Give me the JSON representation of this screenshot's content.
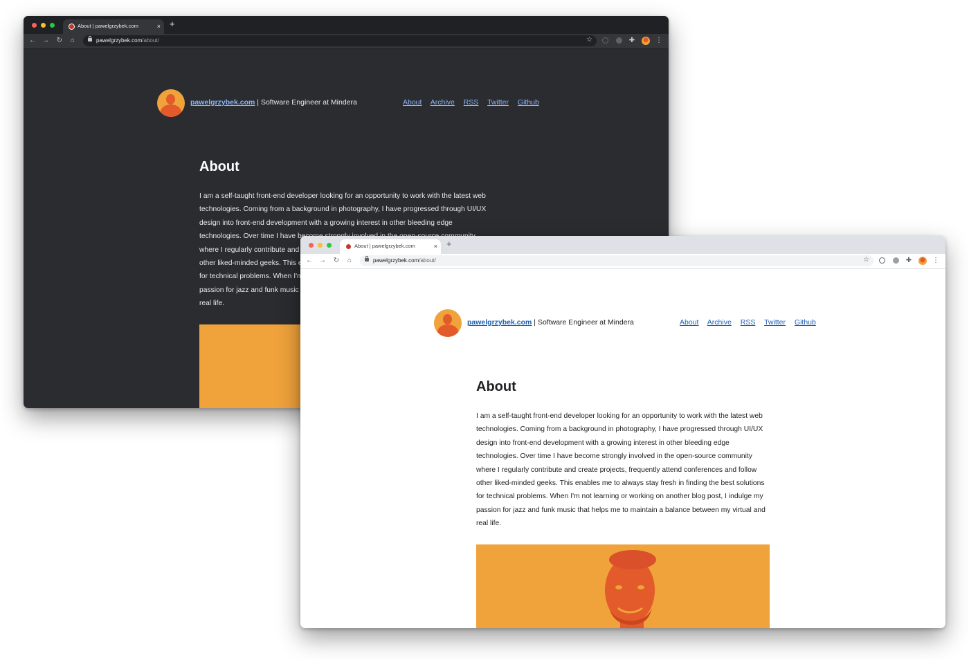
{
  "browser": {
    "tab_title": "About | pawelgrzybek.com",
    "tab_close": "×",
    "new_tab": "+",
    "url_host": "pawelgrzybek.com",
    "url_path": "/about/",
    "icons": {
      "back": "←",
      "forward": "→",
      "reload": "↻",
      "home": "⌂",
      "star": "☆",
      "menu": "⋮",
      "extensions": "✚"
    }
  },
  "site": {
    "name": "pawelgrzybek.com",
    "tagline": "| Software Engineer at Mindera",
    "nav": [
      "About",
      "Archive",
      "RSS",
      "Twitter",
      "Github"
    ]
  },
  "article": {
    "title": "About",
    "body": "I am a self-taught front-end developer looking for an opportunity to work with the latest web technologies. Coming from a background in photography, I have progressed through UI/UX design into front-end development with a growing interest in other bleeding edge technologies. Over time I have become strongly involved in the open-source community where I regularly contribute and create projects, frequently attend conferences and follow other liked-minded geeks. This enables me to always stay fresh in finding the best solutions for technical problems. When I'm not learning or working on another blog post, I indulge my passion for jazz and funk music that helps me to maintain a balance between my virtual and real life."
  },
  "colors": {
    "dark_bg": "#2b2c30",
    "light_bg": "#ffffff",
    "accent_orange": "#f0a23b",
    "portrait_red": "#e35a2b",
    "link_dark": "#8ab4f8",
    "link_light": "#1a5fb4"
  }
}
